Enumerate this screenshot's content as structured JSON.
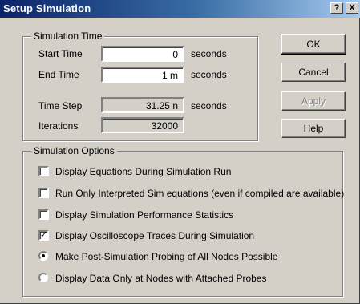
{
  "window": {
    "title": "Setup Simulation",
    "help_glyph": "?",
    "close_glyph": "X"
  },
  "simulation_time": {
    "group_label": "Simulation Time",
    "start_time": {
      "label": "Start Time",
      "value": "0",
      "unit": "seconds"
    },
    "end_time": {
      "label": "End Time",
      "value": "1 m",
      "unit": "seconds"
    },
    "time_step": {
      "label": "Time Step",
      "value": "31.25 n",
      "unit": "seconds"
    },
    "iterations": {
      "label": "Iterations",
      "value": "32000"
    }
  },
  "buttons": {
    "ok": "OK",
    "cancel": "Cancel",
    "apply": "Apply",
    "help": "Help"
  },
  "simulation_options": {
    "group_label": "Simulation Options",
    "checkboxes": [
      {
        "label": "Display Equations During Simulation Run",
        "checked": false
      },
      {
        "label": "Run Only Interpreted Sim equations (even if compiled are available)",
        "checked": false
      },
      {
        "label": "Display Simulation Performance Statistics",
        "checked": false
      },
      {
        "label": "Display Oscilloscope Traces During Simulation",
        "checked": true
      }
    ],
    "radios": [
      {
        "label": "Make Post-Simulation Probing of All Nodes Possible",
        "selected": true
      },
      {
        "label": "Display Data Only at Nodes with Attached Probes",
        "selected": false
      }
    ]
  }
}
